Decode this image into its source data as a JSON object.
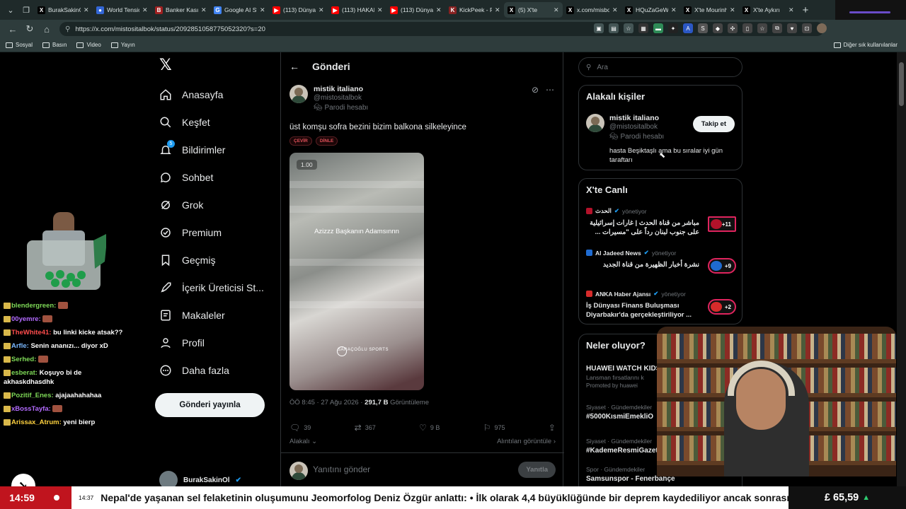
{
  "browser": {
    "tabs": [
      {
        "title": "BurakSakinOl",
        "fav": "X",
        "color": "#000000",
        "active": false
      },
      {
        "title": "World Tension",
        "fav": "●",
        "color": "#3367d6",
        "active": false
      },
      {
        "title": "Banker Kasım",
        "fav": "B",
        "color": "#a02020",
        "active": false
      },
      {
        "title": "Google AI Stu",
        "fav": "G",
        "color": "#4285f4",
        "active": false
      },
      {
        "title": "(113) Dünya",
        "fav": "▶",
        "color": "#ff0000",
        "active": false
      },
      {
        "title": "(113) HAKAN",
        "fav": "▶",
        "color": "#ff0000",
        "active": false
      },
      {
        "title": "(113) Dünya",
        "fav": "▶",
        "color": "#ff0000",
        "active": false
      },
      {
        "title": "KickPeek - R",
        "fav": "K",
        "color": "#882222",
        "active": false
      },
      {
        "title": "(5) X'te",
        "fav": "X",
        "color": "#000000",
        "active": true
      },
      {
        "title": "x.com/misbo",
        "fav": "X",
        "color": "#000000",
        "active": false
      },
      {
        "title": "HQuZaGeW",
        "fav": "X",
        "color": "#000000",
        "active": false
      },
      {
        "title": "X'te Mourinh",
        "fav": "X",
        "color": "#000000",
        "active": false
      },
      {
        "title": "X'te Aykırı",
        "fav": "X",
        "color": "#000000",
        "active": false
      }
    ],
    "url": "https://x.com/mistositalbok/status/2092851058775052320?s=20",
    "bookmarks": [
      "Sosyal",
      "Basın",
      "Video",
      "Yayın"
    ],
    "other_bookmarks": "Diğer sık kullanılanlar"
  },
  "chat": [
    {
      "user": "blendergreen:",
      "color": "#7ed957",
      "msg": ""
    },
    {
      "user": "00yemre:",
      "color": "#b36bff",
      "msg": ""
    },
    {
      "user": "TheWhite41:",
      "color": "#ff4d4d",
      "msg": "bu linki kicke atsak??"
    },
    {
      "user": "Arfle:",
      "color": "#7ab8ff",
      "msg": "Senin ananızı... diyor xD"
    },
    {
      "user": "Serhed:",
      "color": "#7ed957",
      "msg": ""
    },
    {
      "user": "esberat:",
      "color": "#7ed957",
      "msg": "Koşuyo bi de akhaskdhasdhk"
    },
    {
      "user": "Pozitif_Enes:",
      "color": "#7ed957",
      "msg": "ajajaahahahaa"
    },
    {
      "user": "xBossTayfa:",
      "color": "#b36bff",
      "msg": ""
    },
    {
      "user": "Arissax_Atrum:",
      "color": "#ffd23f",
      "msg": "yeni bierp"
    }
  ],
  "xnav": {
    "items": [
      "Anasayfa",
      "Keşfet",
      "Bildirimler",
      "Sohbet",
      "Grok",
      "Premium",
      "Geçmiş",
      "İçerik Üreticisi St...",
      "Makaleler",
      "Profil",
      "Daha fazla"
    ],
    "notif_count": "5",
    "post_button": "Gönderi yayınla",
    "account": "BurakSakinOl"
  },
  "post": {
    "header": "Gönderi",
    "author_name": "mistik italiano",
    "author_handle": "@mistositalbok",
    "parody": "Parodi hesabı",
    "text": "üst komşu sofra bezini bizim balkona silkeleyince",
    "chips": [
      "ÇEVİR",
      "DİNLE"
    ],
    "video_speed": "1.00",
    "video_caption": "Azizzz Başkanın Adamsınnn",
    "video_watermark": "SARAÇOĞLU SPORTS",
    "timestamp": "ÖÖ 8:45 · 27 Ağu 2026 ·",
    "views": "291,7 B",
    "views_label": "Görüntüleme",
    "replies": "39",
    "reposts": "367",
    "likes": "9 B",
    "bookmarks": "975",
    "relevancy": "Alakalı",
    "quotes_link": "Alıntıları görüntüle",
    "reply_placeholder": "Yanıtını gönder",
    "reply_button": "Yanıtla"
  },
  "right": {
    "search_placeholder": "Ara",
    "related_title": "Alakalı kişiler",
    "related_name": "mistik italiano",
    "related_handle": "@mistositalbok",
    "related_parody": "Parodi hesabı",
    "follow_label": "Takip et",
    "related_bio": "hasta Beşiktaşlı ama bu sıralar iyi gün taraftarı",
    "live_title": "X'te Canlı",
    "live_items": [
      {
        "source": "الحدث",
        "host": "yönetiyor",
        "title": "مباشر من قناة الحدث | غارات إسرائيلية على جنوب لبنان رداً على \"مسيرات ...",
        "count": "+11",
        "rtl": true,
        "color": "#b3122a"
      },
      {
        "source": "Al Jadeed News",
        "host": "yönetiyor",
        "title": "نشرة أخبار الظهيرة من قناة الجديد",
        "count": "+9",
        "rtl": true,
        "color": "#1f6bd1"
      },
      {
        "source": "ANKA Haber Ajansı",
        "host": "yönetiyor",
        "title": "İş Dünyası Finans Buluşması Diyarbakır'da gerçekleştiriliyor ...",
        "count": "+2",
        "rtl": false,
        "color": "#d62b2b"
      }
    ],
    "trends_title": "Neler oluyor?",
    "trends": [
      {
        "cat": "",
        "title": "HUAWEI WATCH KIDS",
        "sub": "Lansman fırsatlarını k",
        "promo": "Promoted by huawei"
      },
      {
        "cat": "Siyaset · Gündemdekiler",
        "title": "#5000KısmiEmekliO",
        "sub": "",
        "promo": ""
      },
      {
        "cat": "Siyaset · Gündemdekiler",
        "title": "#KademeResmiGazet",
        "sub": "",
        "promo": ""
      },
      {
        "cat": "Spor · Gündemdekiler",
        "title": "Samsunspor - Fenerbahçe",
        "sub": "",
        "promo": ""
      }
    ]
  },
  "ticker": {
    "clock": "14:59",
    "time": "14:37",
    "text": "Nepal'de yaşanan sel felaketinin oluşumunu Jeomorfolog Deniz Özgür anlattı: • İlk olarak 4,4 büyüklüğünde bir deprem kaydediliyor ancak sonrasında",
    "price": "£ 65,59",
    "price_trend": "▲"
  }
}
